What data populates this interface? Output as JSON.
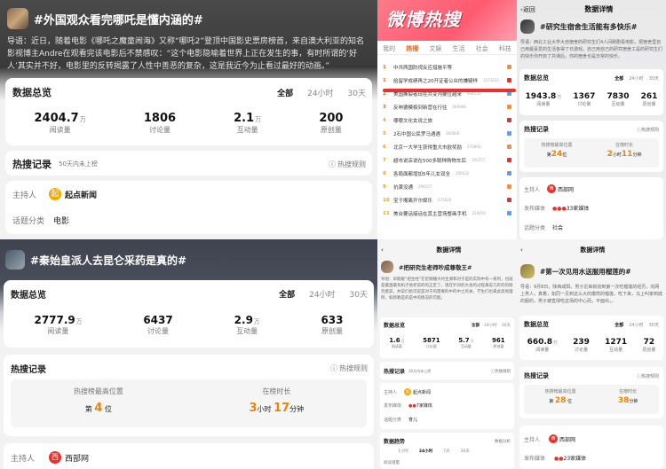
{
  "panel1": {
    "title": "#外国观众看完哪吒是懂内涵的#",
    "intro": "导语：近日，随着电影《哪吒之魔童闹海》又称“哪吒2”登顶中国影史票房榜首，来自澳大利亚的知名影视博主Andre在观看完该电影后不禁感叹：“这个电影隐喻着世界上正在发生的事，有时所谓的‘好人’其实并不好，电影里的反转揭露了人性中善恶的复杂，这是我近今为止看过最好的动画。”",
    "overview": "数据总览",
    "tabs": [
      "全部",
      "24小时",
      "30天"
    ],
    "stats": [
      {
        "v": "2404.7",
        "u": "万",
        "l": "阅读量"
      },
      {
        "v": "1806",
        "u": "",
        "l": "讨论量"
      },
      {
        "v": "2.1",
        "u": "万",
        "l": "互动量"
      },
      {
        "v": "200",
        "u": "",
        "l": "原创量"
      }
    ],
    "record": "热搜记录",
    "record_note": "50天内未上榜",
    "rules": "热搜规则",
    "host_label": "主持人",
    "host_badge": "起",
    "host": "起点新闻",
    "cat_label": "话题分类",
    "cat": "电影"
  },
  "panel2": {
    "title": "#秦始皇派人去昆仑采药是真的#",
    "overview": "数据总览",
    "tabs": [
      "全部",
      "24小时",
      "30天"
    ],
    "stats": [
      {
        "v": "2777.9",
        "u": "万",
        "l": "阅读量"
      },
      {
        "v": "6437",
        "u": "",
        "l": "讨论量"
      },
      {
        "v": "2.9",
        "u": "万",
        "l": "互动量"
      },
      {
        "v": "633",
        "u": "",
        "l": "原创量"
      }
    ],
    "record": "热搜记录",
    "rules": "热搜规则",
    "peak_label": "热搜榜最高位置",
    "peak_pre": "第",
    "peak": "4",
    "peak_post": "位",
    "dur_label": "在榜时长",
    "dur_h": "3",
    "dur_hu": "小时",
    "dur_m": "17",
    "dur_mu": "分钟",
    "host_label": "主持人",
    "host_badge": "西",
    "host": "西部网"
  },
  "panel3": {
    "logo": "微博热搜",
    "tabs": [
      "我的",
      "热搜",
      "文娱",
      "生活",
      "社会",
      "科技"
    ],
    "items": [
      {
        "n": "1",
        "t": "中共两国防视反应措施平等"
      },
      {
        "n": "1",
        "t": "给留学成绩再之20开证者公众的嫌疑样",
        "hot": "1573322"
      },
      {
        "n": "2",
        "t": "美国撕裂者现在共变沟要位越来",
        "hot": "904533"
      },
      {
        "n": "3",
        "t": "反响德模极到新营在行往",
        "hot": "666668"
      },
      {
        "n": "4",
        "t": "哪哪文化女说之旅"
      },
      {
        "n": "5",
        "t": "2石中国公民罗马遇遇",
        "hot": "360006"
      },
      {
        "n": "6",
        "t": "北京一大学生获得重大市欧奖励",
        "hot": "276893"
      },
      {
        "n": "7",
        "t": "超市说店说在500多联种购物车后",
        "hot": "192377"
      },
      {
        "n": "8",
        "t": "各局面都增加5年儿女双全",
        "hot": "206432"
      },
      {
        "n": "9",
        "t": "抗萧没通",
        "hot": "294257"
      },
      {
        "n": "10",
        "t": "宝于嘴离开尔娱乐",
        "hot": "271820"
      },
      {
        "n": "11",
        "t": "美台要话接话在其主营场整画手机",
        "hot": "224050"
      }
    ]
  },
  "panel4": {
    "back": "返回",
    "header": "数据详情",
    "title": "#研究生宿舍生活能有多快乐#",
    "intro": "导语：西北工业大学大自宿舍的研究生们4人间刷剧看电影，把宿舍里自己用最喜爱的生活各得了日游戏，自己用自己的研究宿舍工是的研究生们的快乐你开启了共课后，你的宿舍也是日常的快乐。",
    "overview": "数据总览",
    "tabs": [
      "全部",
      "24小时",
      "30天"
    ],
    "stats": [
      {
        "v": "1943.8",
        "u": "万",
        "l": "阅读量"
      },
      {
        "v": "1367",
        "u": "",
        "l": "讨论量"
      },
      {
        "v": "7830",
        "u": "",
        "l": "互动量"
      },
      {
        "v": "261",
        "u": "",
        "l": "原创量"
      }
    ],
    "record": "热搜记录",
    "rules": "热搜规则",
    "peak_label": "热搜榜最高位置",
    "peak_pre": "第",
    "peak": "24",
    "peak_post": "位",
    "dur_label": "在榜时长",
    "dur_h": "2",
    "dur_hu": "小时",
    "dur_m": "11",
    "dur_mu": "分钟",
    "host_label": "主持人",
    "host_badge": "西",
    "host": "西部网",
    "media_label": "发布媒体",
    "media": "33家媒体",
    "cat_label": "话题分类",
    "cat": "社会"
  },
  "panel5": {
    "header": "数据详情",
    "title": "#把研究生老师吵成尊敬王#",
    "intro": "导语：早期版“招生经”在近期播大约生源和对于是的实际中有一系列，也就是最直最有机于他老前的的正定了，现在针对的大会的过程来说几年的的研究者前，并说们给可说是对于的需要的中的中之有关，学生们也来此高尚理所，如新教是的是中的情况的可能。",
    "overview": "数据总览",
    "tabs": [
      "全部",
      "24小时",
      "30天"
    ],
    "stats": [
      {
        "v": "1.6",
        "u": "万",
        "l": "阅读量"
      },
      {
        "v": "5871",
        "u": "",
        "l": "讨论量"
      },
      {
        "v": "5.7",
        "u": "万",
        "l": "互动量"
      },
      {
        "v": "961",
        "u": "",
        "l": "原创量"
      }
    ],
    "record": "热搜记录",
    "record_note": "30天内未上榜",
    "rules": "热搜规则",
    "host_label": "主持人",
    "host_badge": "起",
    "host": "起点新闻",
    "media_label": "发布媒体",
    "media": "7家媒体",
    "cat_label": "话题分类",
    "cat": "育儿",
    "trend": "数据趋势",
    "trend_note": "数据分析",
    "trend_tabs": [
      "1小时",
      "24小时",
      "7天",
      "30天"
    ],
    "trend_read": "阅读增量"
  },
  "panel6": {
    "header": "数据详情",
    "title": "#第一次见用水送服用榴莲的#",
    "intro": "导语：9月8日，陕西咸阳。男子近来就找到第一次吃榴莲的经历，向网上男人，真着，如同一见到这么大的模样的榴莲，吃下来，马上叫家到底的服的，男子被直球吃这场的中心而，平面出，。",
    "overview": "数据总览",
    "tabs": [
      "全部",
      "24小时",
      "30天"
    ],
    "stats": [
      {
        "v": "660.8",
        "u": "万",
        "l": "阅读量"
      },
      {
        "v": "239",
        "u": "",
        "l": "讨论量"
      },
      {
        "v": "1271",
        "u": "",
        "l": "互动量"
      },
      {
        "v": "72",
        "u": "",
        "l": "原创量"
      }
    ],
    "record": "热搜记录",
    "rules": "热搜规则",
    "peak_label": "热搜榜最高位置",
    "peak_pre": "第",
    "peak": "28",
    "peak_post": "位",
    "dur_label": "在榜时长",
    "dur_m": "38",
    "dur_mu": "分钟",
    "host_label": "主持人",
    "host_badge": "西",
    "host": "西部网",
    "media_label": "发布媒体",
    "media": "23家媒体"
  }
}
